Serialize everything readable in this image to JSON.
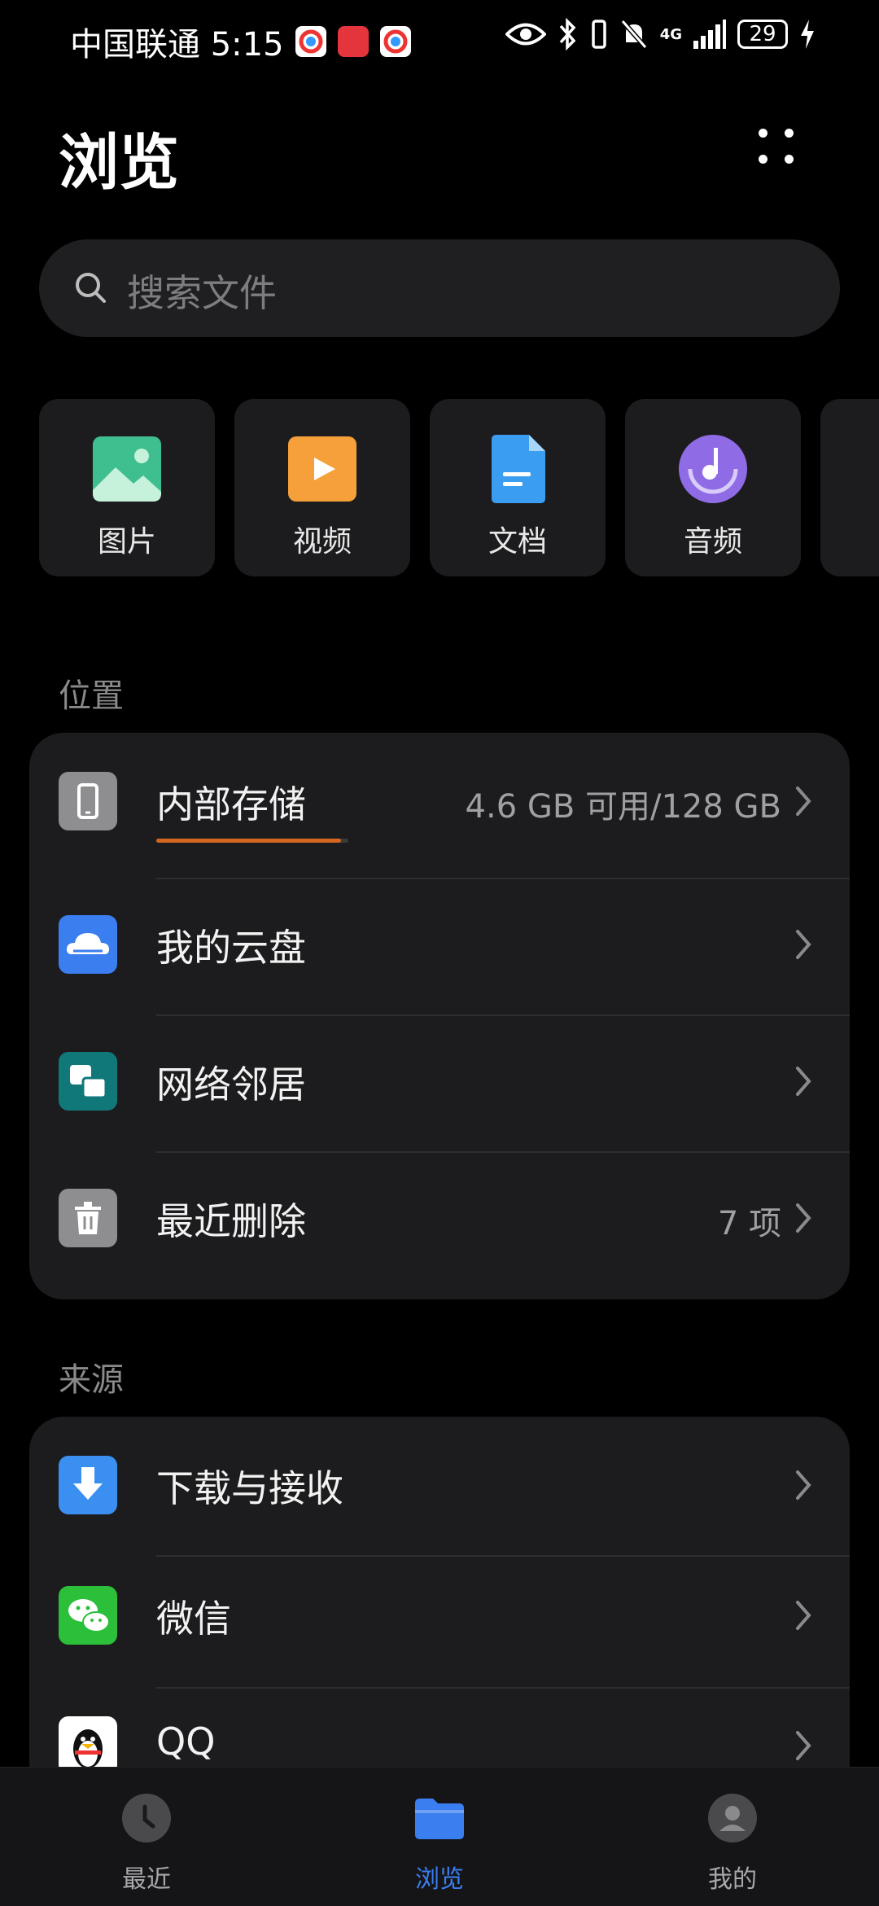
{
  "status_bar": {
    "carrier_time": "中国联通 5:15",
    "battery": "29",
    "network": "4G"
  },
  "header": {
    "title": "浏览"
  },
  "search": {
    "placeholder": "搜索文件"
  },
  "categories": [
    {
      "label": "图片",
      "icon": "image-icon",
      "color": "#3fbf8f"
    },
    {
      "label": "视频",
      "icon": "video-icon",
      "color": "#f5a03a"
    },
    {
      "label": "文档",
      "icon": "document-icon",
      "color": "#3b9df0"
    },
    {
      "label": "音频",
      "icon": "audio-icon",
      "color": "#8f6ce6"
    }
  ],
  "locations": {
    "label": "位置",
    "items": [
      {
        "label": "内部存储",
        "value": "4.6 GB 可用/128 GB",
        "icon": "phone-icon",
        "storage_used_fraction": 0.96
      },
      {
        "label": "我的云盘",
        "value": "",
        "icon": "cloud-icon"
      },
      {
        "label": "网络邻居",
        "value": "",
        "icon": "network-icon"
      },
      {
        "label": "最近删除",
        "value": "7 项",
        "icon": "trash-icon"
      }
    ]
  },
  "sources": {
    "label": "来源",
    "items": [
      {
        "label": "下载与接收",
        "icon": "download-icon"
      },
      {
        "label": "微信",
        "icon": "wechat-icon"
      },
      {
        "label": "QQ",
        "icon": "qq-icon"
      }
    ]
  },
  "bottom_nav": [
    {
      "label": "最近",
      "icon": "clock-icon",
      "active": false
    },
    {
      "label": "浏览",
      "icon": "folder-icon",
      "active": true
    },
    {
      "label": "我的",
      "icon": "person-icon",
      "active": false
    }
  ],
  "colors": {
    "accent": "#3b7ef0",
    "progress": "#d4671f",
    "card": "#1c1c1e",
    "background": "#000000"
  }
}
